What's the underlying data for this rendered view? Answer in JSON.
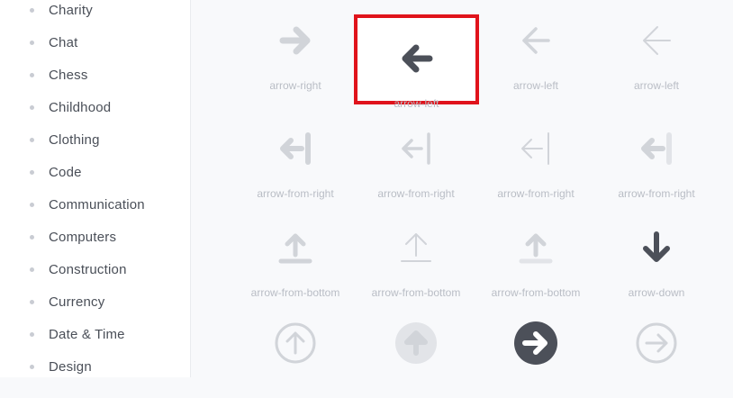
{
  "colors": {
    "dark": "#4c5059",
    "light": "#d1d4d9",
    "faint": "#e2e4e8",
    "selection_border": "#e0131b"
  },
  "sidebar": {
    "items": [
      {
        "label": "Charity"
      },
      {
        "label": "Chat"
      },
      {
        "label": "Chess"
      },
      {
        "label": "Childhood"
      },
      {
        "label": "Clothing"
      },
      {
        "label": "Code"
      },
      {
        "label": "Communication"
      },
      {
        "label": "Computers"
      },
      {
        "label": "Construction"
      },
      {
        "label": "Currency"
      },
      {
        "label": "Date & Time"
      },
      {
        "label": "Design"
      }
    ]
  },
  "icons": [
    {
      "name": "arrow-right",
      "icon": "arrow-right-solid-icon",
      "tone": "light"
    },
    {
      "name": "arrow-left",
      "icon": "arrow-left-solid-icon",
      "tone": "dark",
      "selected": true
    },
    {
      "name": "arrow-left",
      "icon": "arrow-left-regular-icon",
      "tone": "light"
    },
    {
      "name": "arrow-left",
      "icon": "arrow-left-light-icon",
      "tone": "light"
    },
    {
      "name": "arrow-from-right",
      "icon": "arrow-from-right-solid-icon",
      "tone": "light"
    },
    {
      "name": "arrow-from-right",
      "icon": "arrow-from-right-regular-icon",
      "tone": "light"
    },
    {
      "name": "arrow-from-right",
      "icon": "arrow-from-right-light-icon",
      "tone": "light"
    },
    {
      "name": "arrow-from-right",
      "icon": "arrow-from-right-duotone-icon",
      "tone": "light"
    },
    {
      "name": "arrow-from-bottom",
      "icon": "arrow-from-bottom-solid-icon",
      "tone": "light"
    },
    {
      "name": "arrow-from-bottom",
      "icon": "arrow-from-bottom-light-icon",
      "tone": "light"
    },
    {
      "name": "arrow-from-bottom",
      "icon": "arrow-from-bottom-duotone-icon",
      "tone": "light"
    },
    {
      "name": "arrow-down",
      "icon": "arrow-down-solid-icon",
      "tone": "dark"
    },
    {
      "name": "",
      "icon": "arrow-circle-up-outline-icon",
      "tone": "light"
    },
    {
      "name": "",
      "icon": "arrow-circle-up-duotone-icon",
      "tone": "light"
    },
    {
      "name": "",
      "icon": "arrow-circle-right-solid-icon",
      "tone": "dark"
    },
    {
      "name": "",
      "icon": "arrow-circle-right-outline-icon",
      "tone": "light"
    }
  ]
}
